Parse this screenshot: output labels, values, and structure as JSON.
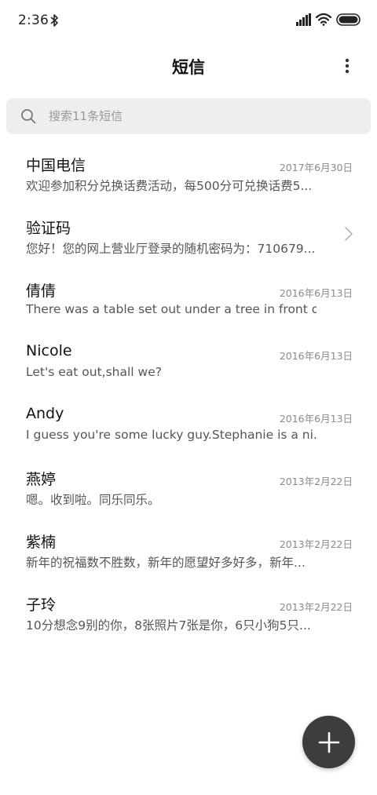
{
  "status_bar": {
    "time": "2:36",
    "icons": [
      "bluetooth-icon",
      "signal-icon",
      "wifi-icon",
      "battery-icon"
    ]
  },
  "header": {
    "title": "短信",
    "more_icon": "more-vertical-icon"
  },
  "search": {
    "placeholder": "搜索11条短信",
    "icon": "search-icon"
  },
  "messages": [
    {
      "sender": "中国电信",
      "date": "2017年6月30日",
      "preview": "欢迎参加积分兑换话费活动，每500分可兑换话费5..."
    },
    {
      "sender": "验证码",
      "date": "",
      "preview": "您好！您的网上营业厅登录的随机密码为：710679...",
      "icon": "chevron-right-icon"
    },
    {
      "sender": "倩倩",
      "date": "2016年6月13日",
      "preview": "There was a table set out under a tree in front of ..."
    },
    {
      "sender": "Nicole",
      "date": "2016年6月13日",
      "preview": "Let's eat out,shall we?"
    },
    {
      "sender": "Andy",
      "date": "2016年6月13日",
      "preview": "I guess you're some lucky guy.Stephanie is a ni..."
    },
    {
      "sender": "燕婷",
      "date": "2013年2月22日",
      "preview": "嗯。收到啦。同乐同乐。"
    },
    {
      "sender": "紫楠",
      "date": "2013年2月22日",
      "preview": "新年的祝福数不胜数，新年的愿望好多好多，新年..."
    },
    {
      "sender": "子玲",
      "date": "2013年2月22日",
      "preview": "10分想念9别的你，8张照片7张是你，6只小狗5只..."
    }
  ],
  "fab": {
    "icon": "plus-icon"
  },
  "colors": {
    "background": "#ffffff",
    "search_bg": "#eeeeee",
    "fab_bg": "#3d3d3d",
    "secondary_text": "#8a8a8a"
  }
}
